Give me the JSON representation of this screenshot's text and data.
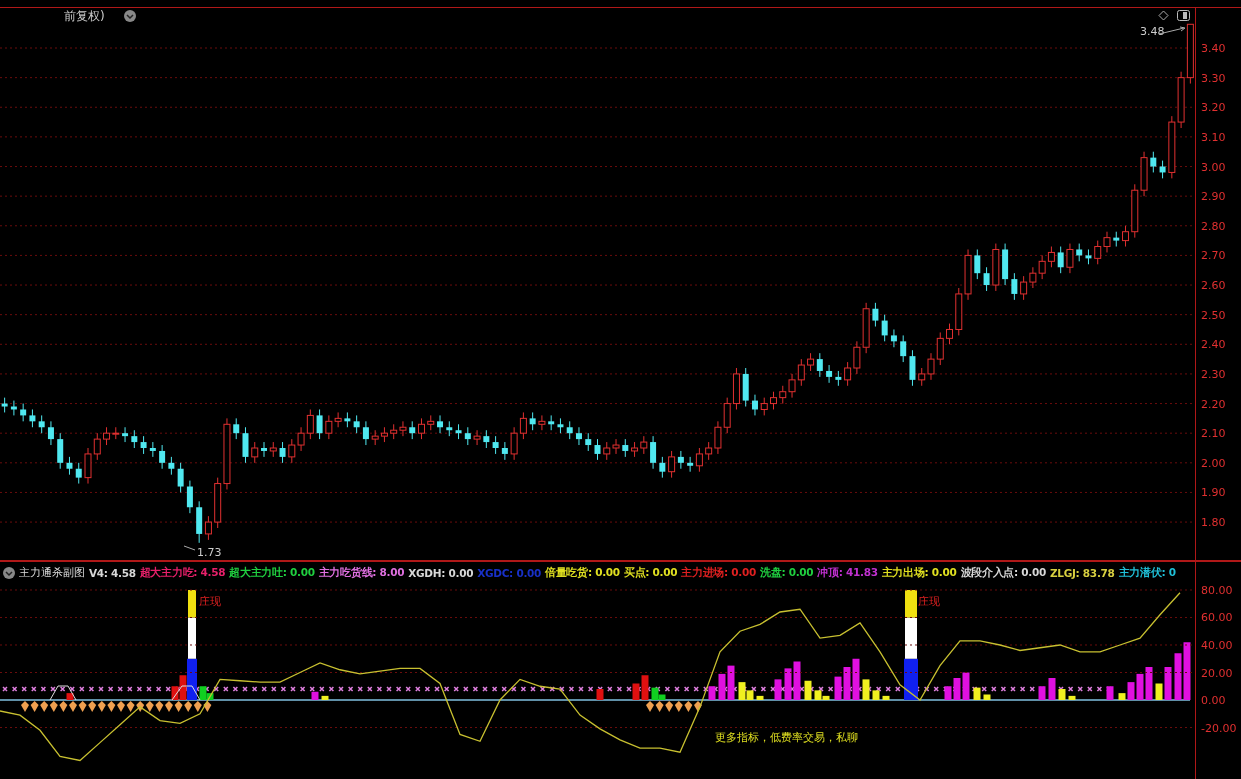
{
  "main_chart": {
    "title": "前复权)",
    "high_label": "3.48",
    "low_label": "1.73",
    "chart_data": {
      "type": "candlestick",
      "ylim": [
        1.672,
        3.535
      ],
      "grid": true,
      "yticks": [
        {
          "value": 3.4,
          "label": "3.40"
        },
        {
          "value": 3.3,
          "label": "3.30"
        },
        {
          "value": 3.2,
          "label": "3.20"
        },
        {
          "value": 3.1,
          "label": "3.10"
        },
        {
          "value": 3.0,
          "label": "3.00"
        },
        {
          "value": 2.9,
          "label": "2.90"
        },
        {
          "value": 2.8,
          "label": "2.80"
        },
        {
          "value": 2.7,
          "label": "2.70"
        },
        {
          "value": 2.6,
          "label": "2.60"
        },
        {
          "value": 2.5,
          "label": "2.50"
        },
        {
          "value": 2.4,
          "label": "2.40"
        },
        {
          "value": 2.3,
          "label": "2.30"
        },
        {
          "value": 2.2,
          "label": "2.20"
        },
        {
          "value": 2.1,
          "label": "2.10"
        },
        {
          "value": 2.0,
          "label": "2.00"
        },
        {
          "value": 1.9,
          "label": "1.90"
        },
        {
          "value": 1.8,
          "label": "1.80"
        }
      ],
      "ohlc": [
        [
          2.2,
          2.22,
          2.17,
          2.19
        ],
        [
          2.19,
          2.21,
          2.16,
          2.18
        ],
        [
          2.18,
          2.2,
          2.14,
          2.16
        ],
        [
          2.16,
          2.18,
          2.12,
          2.14
        ],
        [
          2.14,
          2.16,
          2.1,
          2.12
        ],
        [
          2.12,
          2.14,
          2.06,
          2.08
        ],
        [
          2.08,
          2.1,
          1.98,
          2.0
        ],
        [
          2.0,
          2.02,
          1.96,
          1.98
        ],
        [
          1.98,
          2.0,
          1.93,
          1.95
        ],
        [
          1.95,
          2.05,
          1.93,
          2.03
        ],
        [
          2.03,
          2.1,
          2.01,
          2.08
        ],
        [
          2.08,
          2.12,
          2.06,
          2.1
        ],
        [
          2.1,
          2.12,
          2.08,
          2.1
        ],
        [
          2.1,
          2.12,
          2.07,
          2.09
        ],
        [
          2.09,
          2.11,
          2.05,
          2.07
        ],
        [
          2.07,
          2.09,
          2.03,
          2.05
        ],
        [
          2.05,
          2.07,
          2.02,
          2.04
        ],
        [
          2.04,
          2.06,
          1.98,
          2.0
        ],
        [
          2.0,
          2.02,
          1.96,
          1.98
        ],
        [
          1.98,
          2.0,
          1.9,
          1.92
        ],
        [
          1.92,
          1.94,
          1.83,
          1.85
        ],
        [
          1.85,
          1.87,
          1.73,
          1.76
        ],
        [
          1.76,
          1.82,
          1.74,
          1.8
        ],
        [
          1.8,
          1.95,
          1.78,
          1.93
        ],
        [
          1.93,
          2.15,
          1.91,
          2.13
        ],
        [
          2.13,
          2.15,
          2.08,
          2.1
        ],
        [
          2.1,
          2.12,
          2.0,
          2.02
        ],
        [
          2.02,
          2.07,
          2.0,
          2.05
        ],
        [
          2.05,
          2.07,
          2.02,
          2.04
        ],
        [
          2.04,
          2.07,
          2.02,
          2.05
        ],
        [
          2.05,
          2.07,
          2.0,
          2.02
        ],
        [
          2.02,
          2.08,
          2.0,
          2.06
        ],
        [
          2.06,
          2.12,
          2.04,
          2.1
        ],
        [
          2.1,
          2.18,
          2.08,
          2.16
        ],
        [
          2.16,
          2.18,
          2.08,
          2.1
        ],
        [
          2.1,
          2.16,
          2.08,
          2.14
        ],
        [
          2.14,
          2.17,
          2.12,
          2.15
        ],
        [
          2.15,
          2.17,
          2.12,
          2.14
        ],
        [
          2.14,
          2.16,
          2.1,
          2.12
        ],
        [
          2.12,
          2.14,
          2.06,
          2.08
        ],
        [
          2.08,
          2.11,
          2.06,
          2.09
        ],
        [
          2.09,
          2.12,
          2.07,
          2.1
        ],
        [
          2.1,
          2.13,
          2.08,
          2.11
        ],
        [
          2.11,
          2.14,
          2.09,
          2.12
        ],
        [
          2.12,
          2.14,
          2.08,
          2.1
        ],
        [
          2.1,
          2.15,
          2.08,
          2.13
        ],
        [
          2.13,
          2.16,
          2.11,
          2.14
        ],
        [
          2.14,
          2.16,
          2.1,
          2.12
        ],
        [
          2.12,
          2.14,
          2.09,
          2.11
        ],
        [
          2.11,
          2.13,
          2.08,
          2.1
        ],
        [
          2.1,
          2.12,
          2.06,
          2.08
        ],
        [
          2.08,
          2.11,
          2.06,
          2.09
        ],
        [
          2.09,
          2.11,
          2.05,
          2.07
        ],
        [
          2.07,
          2.09,
          2.03,
          2.05
        ],
        [
          2.05,
          2.07,
          2.01,
          2.03
        ],
        [
          2.03,
          2.12,
          2.01,
          2.1
        ],
        [
          2.1,
          2.17,
          2.08,
          2.15
        ],
        [
          2.15,
          2.17,
          2.11,
          2.13
        ],
        [
          2.13,
          2.16,
          2.11,
          2.14
        ],
        [
          2.14,
          2.16,
          2.11,
          2.13
        ],
        [
          2.13,
          2.15,
          2.1,
          2.12
        ],
        [
          2.12,
          2.14,
          2.08,
          2.1
        ],
        [
          2.1,
          2.12,
          2.06,
          2.08
        ],
        [
          2.08,
          2.1,
          2.04,
          2.06
        ],
        [
          2.06,
          2.08,
          2.01,
          2.03
        ],
        [
          2.03,
          2.07,
          2.01,
          2.05
        ],
        [
          2.05,
          2.08,
          2.03,
          2.06
        ],
        [
          2.06,
          2.08,
          2.02,
          2.04
        ],
        [
          2.04,
          2.07,
          2.02,
          2.05
        ],
        [
          2.05,
          2.09,
          2.03,
          2.07
        ],
        [
          2.07,
          2.09,
          1.98,
          2.0
        ],
        [
          2.0,
          2.02,
          1.95,
          1.97
        ],
        [
          1.97,
          2.04,
          1.95,
          2.02
        ],
        [
          2.02,
          2.04,
          1.98,
          2.0
        ],
        [
          2.0,
          2.02,
          1.97,
          1.99
        ],
        [
          1.99,
          2.05,
          1.97,
          2.03
        ],
        [
          2.03,
          2.07,
          2.01,
          2.05
        ],
        [
          2.05,
          2.14,
          2.03,
          2.12
        ],
        [
          2.12,
          2.22,
          2.1,
          2.2
        ],
        [
          2.2,
          2.32,
          2.18,
          2.3
        ],
        [
          2.3,
          2.32,
          2.19,
          2.21
        ],
        [
          2.21,
          2.23,
          2.16,
          2.18
        ],
        [
          2.18,
          2.22,
          2.16,
          2.2
        ],
        [
          2.2,
          2.24,
          2.18,
          2.22
        ],
        [
          2.22,
          2.26,
          2.2,
          2.24
        ],
        [
          2.24,
          2.3,
          2.22,
          2.28
        ],
        [
          2.28,
          2.35,
          2.26,
          2.33
        ],
        [
          2.33,
          2.37,
          2.31,
          2.35
        ],
        [
          2.35,
          2.37,
          2.29,
          2.31
        ],
        [
          2.31,
          2.33,
          2.27,
          2.29
        ],
        [
          2.29,
          2.31,
          2.26,
          2.28
        ],
        [
          2.28,
          2.34,
          2.26,
          2.32
        ],
        [
          2.32,
          2.41,
          2.3,
          2.39
        ],
        [
          2.39,
          2.54,
          2.37,
          2.52
        ],
        [
          2.52,
          2.54,
          2.46,
          2.48
        ],
        [
          2.48,
          2.5,
          2.41,
          2.43
        ],
        [
          2.43,
          2.45,
          2.39,
          2.41
        ],
        [
          2.41,
          2.43,
          2.34,
          2.36
        ],
        [
          2.36,
          2.38,
          2.26,
          2.28
        ],
        [
          2.28,
          2.32,
          2.26,
          2.3
        ],
        [
          2.3,
          2.37,
          2.28,
          2.35
        ],
        [
          2.35,
          2.44,
          2.33,
          2.42
        ],
        [
          2.42,
          2.47,
          2.4,
          2.45
        ],
        [
          2.45,
          2.59,
          2.43,
          2.57
        ],
        [
          2.57,
          2.72,
          2.55,
          2.7
        ],
        [
          2.7,
          2.72,
          2.62,
          2.64
        ],
        [
          2.64,
          2.66,
          2.58,
          2.6
        ],
        [
          2.6,
          2.74,
          2.58,
          2.72
        ],
        [
          2.72,
          2.74,
          2.6,
          2.62
        ],
        [
          2.62,
          2.64,
          2.55,
          2.57
        ],
        [
          2.57,
          2.63,
          2.55,
          2.61
        ],
        [
          2.61,
          2.66,
          2.59,
          2.64
        ],
        [
          2.64,
          2.7,
          2.62,
          2.68
        ],
        [
          2.68,
          2.73,
          2.66,
          2.71
        ],
        [
          2.71,
          2.73,
          2.64,
          2.66
        ],
        [
          2.66,
          2.74,
          2.64,
          2.72
        ],
        [
          2.72,
          2.74,
          2.68,
          2.7
        ],
        [
          2.7,
          2.72,
          2.67,
          2.69
        ],
        [
          2.69,
          2.75,
          2.67,
          2.73
        ],
        [
          2.73,
          2.78,
          2.71,
          2.76
        ],
        [
          2.76,
          2.78,
          2.73,
          2.75
        ],
        [
          2.75,
          2.8,
          2.73,
          2.78
        ],
        [
          2.78,
          2.94,
          2.76,
          2.92
        ],
        [
          2.92,
          3.05,
          2.9,
          3.03
        ],
        [
          3.03,
          3.05,
          2.98,
          3.0
        ],
        [
          3.0,
          3.02,
          2.96,
          2.98
        ],
        [
          2.98,
          3.17,
          2.96,
          3.15
        ],
        [
          3.15,
          3.32,
          3.13,
          3.3
        ],
        [
          3.3,
          3.48,
          3.28,
          3.48
        ]
      ]
    }
  },
  "indicator": {
    "title": "主力通杀副图",
    "legend": [
      {
        "text": "V4: 4.58",
        "color": "#d8d8d8"
      },
      {
        "text": "超大主力吃: 4.58",
        "color": "#e8206a"
      },
      {
        "text": "超大主力吐: 0.00",
        "color": "#20d040"
      },
      {
        "text": "主力吃货线: 8.00",
        "color": "#e070e0"
      },
      {
        "text": "XGDH: 0.00",
        "color": "#d8d8d8"
      },
      {
        "text": "XGDC: 0.00",
        "color": "#1830c8"
      },
      {
        "text": "倍量吃货: 0.00",
        "color": "#e0e020"
      },
      {
        "text": "买点: 0.00",
        "color": "#e0e020"
      },
      {
        "text": "主力进场: 0.00",
        "color": "#e02020"
      },
      {
        "text": "洗盘: 0.00",
        "color": "#20d040"
      },
      {
        "text": "冲顶: 41.83",
        "color": "#c030d0"
      },
      {
        "text": "主力出场: 0.00",
        "color": "#e0e020"
      },
      {
        "text": "波段介入点: 0.00",
        "color": "#d8d8d8"
      },
      {
        "text": "ZLGJ: 83.78",
        "color": "#d8d040"
      },
      {
        "text": "主力潜伏: 0",
        "color": "#20c0d8"
      }
    ],
    "markers": [
      "庄现",
      "庄现"
    ],
    "note": "更多指标，低费率交易，私聊",
    "chart_data": {
      "type": "line",
      "ylim": [
        -57.45,
        100.36
      ],
      "grid": true,
      "yticks": [
        {
          "value": 80,
          "label": "80.00"
        },
        {
          "value": 60,
          "label": "60.00"
        },
        {
          "value": 40,
          "label": "40.00"
        },
        {
          "value": 20,
          "label": "20.00"
        },
        {
          "value": 0,
          "label": "0.00"
        },
        {
          "value": -20,
          "label": "-20.00"
        }
      ],
      "series": [
        {
          "color": "#c8c030",
          "values": [
            -8,
            -11,
            -22,
            -41,
            -44,
            -31,
            -18,
            -5,
            -15,
            -17,
            -10,
            15,
            14,
            13,
            13,
            20,
            27,
            22,
            19,
            21,
            23,
            23,
            12,
            -25,
            -30,
            0,
            15,
            10,
            8,
            -11,
            -21,
            -29,
            -35,
            -35,
            -38,
            -5,
            35,
            50,
            55,
            64,
            66,
            45,
            47,
            56,
            35,
            11,
            0,
            25,
            43,
            43,
            40,
            36,
            38,
            40,
            35,
            35,
            40,
            45,
            62,
            78
          ]
        }
      ]
    }
  }
}
